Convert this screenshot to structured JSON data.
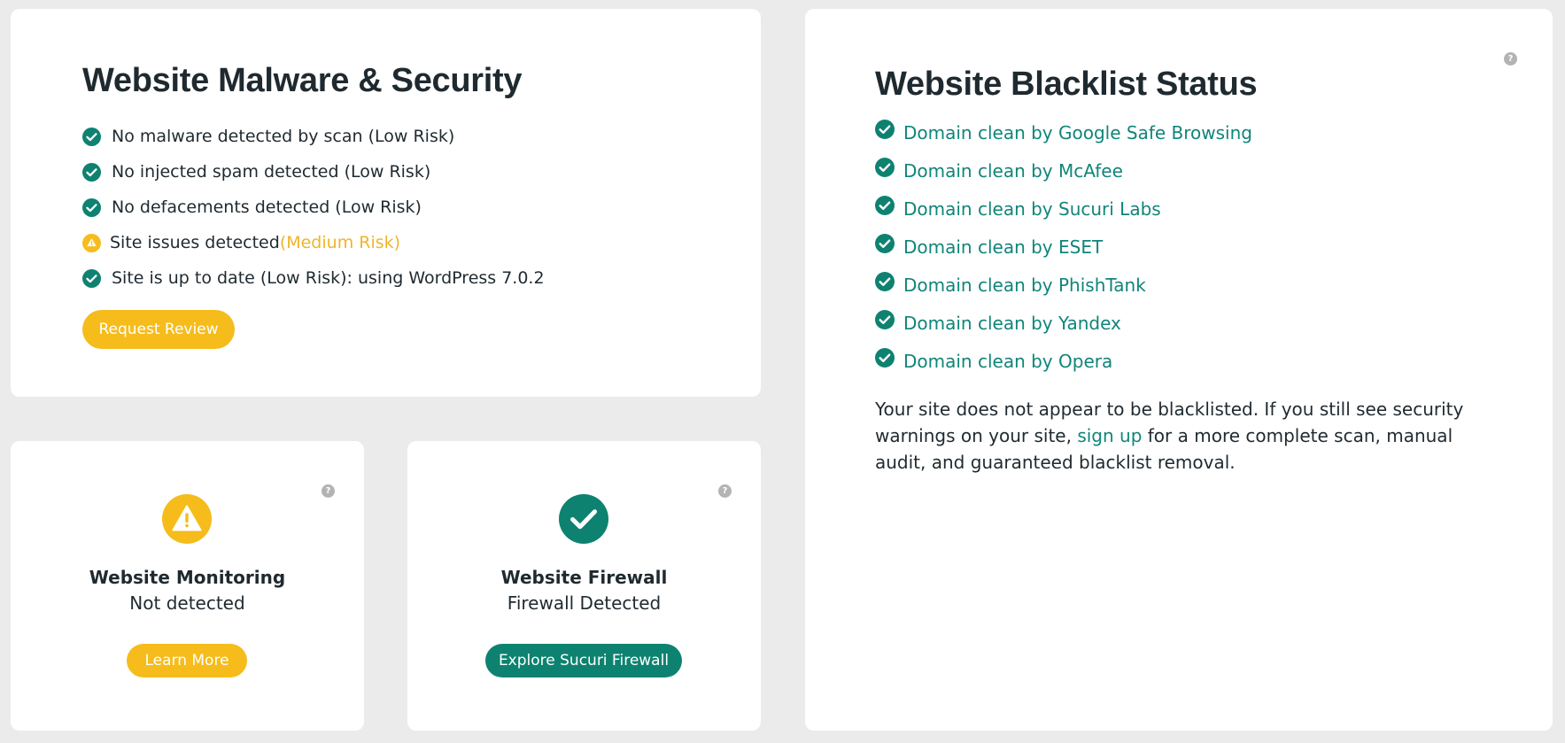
{
  "malware_card": {
    "title": "Website Malware & Security",
    "items": [
      {
        "text": "No malware detected by scan (Low Risk)",
        "status": "ok"
      },
      {
        "text": "No injected spam detected (Low Risk)",
        "status": "ok"
      },
      {
        "text": "No defacements detected (Low Risk)",
        "status": "ok"
      },
      {
        "text": "Site issues detected ",
        "risk": "(Medium Risk)",
        "status": "warning"
      },
      {
        "text": "Site is up to date (Low Risk): using WordPress 7.0.2",
        "status": "ok"
      }
    ],
    "button_label": "Request Review"
  },
  "monitoring_card": {
    "title": "Website Monitoring",
    "status": "Not detected",
    "icon": "warning-icon",
    "button_label": "Learn More"
  },
  "firewall_card": {
    "title": "Website Firewall",
    "status": "Firewall Detected",
    "icon": "check-circle-icon",
    "button_label": "Explore Sucuri Firewall"
  },
  "blacklist_card": {
    "title": "Website Blacklist Status",
    "items": [
      "Domain clean by Google Safe Browsing",
      "Domain clean by McAfee",
      "Domain clean by Sucuri Labs",
      "Domain clean by ESET",
      "Domain clean by PhishTank",
      "Domain clean by Yandex",
      "Domain clean by Opera"
    ],
    "note_before": "Your site does not appear to be blacklisted. If you still see security warnings on your site, ",
    "note_link": "sign up",
    "note_after": " for a more complete scan, manual audit, and guaranteed blacklist removal."
  },
  "help_glyph": "?",
  "colors": {
    "brand_green": "#0e8270",
    "link_green": "#10857a",
    "warning_yellow": "#f5bc1c",
    "medium_risk": "#f0b429",
    "text_dark": "#1f2a30",
    "background": "#ebebeb"
  }
}
